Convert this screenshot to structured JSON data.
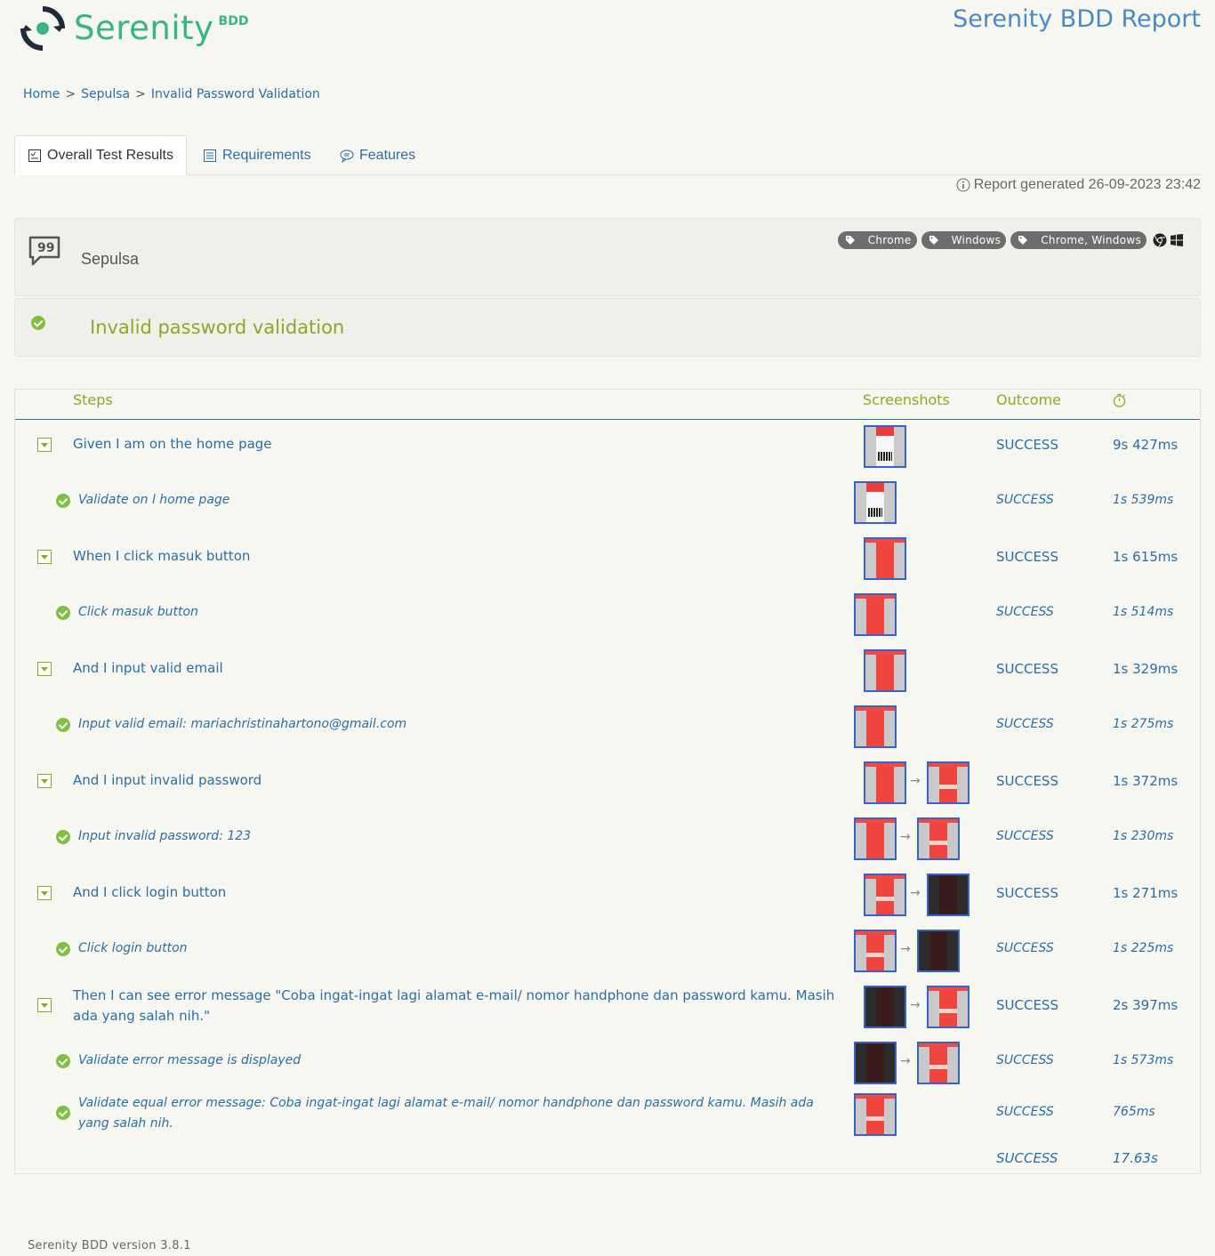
{
  "header": {
    "logo_text": "Serenity",
    "logo_sup": "BDD",
    "report_title": "Serenity BDD Report"
  },
  "breadcrumb": {
    "home": "Home",
    "sep": ">",
    "feature": "Sepulsa",
    "scenario": "Invalid Password Validation"
  },
  "tabs": [
    {
      "label": "Overall Test Results",
      "icon": "checklist-icon"
    },
    {
      "label": "Requirements",
      "icon": "list-icon"
    },
    {
      "label": "Features",
      "icon": "comment-icon"
    }
  ],
  "report_generated": "Report generated 26-09-2023 23:42",
  "feature": {
    "name": "Sepulsa",
    "tags": [
      "Chrome",
      "Windows",
      "Chrome, Windows"
    ]
  },
  "scenario": {
    "title": "Invalid password validation"
  },
  "table": {
    "headers": {
      "steps": "Steps",
      "screenshots": "Screenshots",
      "outcome": "Outcome",
      "duration": "stopwatch-icon"
    },
    "rows": [
      {
        "text": "Given I am on the home page",
        "outcome": "SUCCESS",
        "duration": "9s 427ms"
      },
      {
        "text": "Validate on l home page",
        "outcome": "SUCCESS",
        "duration": "1s 539ms"
      },
      {
        "text": "When I click masuk button",
        "outcome": "SUCCESS",
        "duration": "1s 615ms"
      },
      {
        "text": "Click masuk button",
        "outcome": "SUCCESS",
        "duration": "1s 514ms"
      },
      {
        "text": "And I input valid email",
        "outcome": "SUCCESS",
        "duration": "1s 329ms"
      },
      {
        "text": "Input valid email: mariachristinahartono@gmail.com",
        "outcome": "SUCCESS",
        "duration": "1s 275ms"
      },
      {
        "text": "And I input invalid password",
        "outcome": "SUCCESS",
        "duration": "1s 372ms"
      },
      {
        "text": "Input invalid password: 123",
        "outcome": "SUCCESS",
        "duration": "1s 230ms"
      },
      {
        "text": "And I click login button",
        "outcome": "SUCCESS",
        "duration": "1s 271ms"
      },
      {
        "text": "Click login button",
        "outcome": "SUCCESS",
        "duration": "1s 225ms"
      },
      {
        "text": "Then I can see error message \"Coba ingat-ingat lagi alamat e-mail/ nomor handphone dan password kamu. Masih ada yang salah nih.\"",
        "outcome": "SUCCESS",
        "duration": "2s 397ms"
      },
      {
        "text": "Validate error message is displayed",
        "outcome": "SUCCESS",
        "duration": "1s 573ms"
      },
      {
        "text": "Validate equal error message: Coba ingat-ingat lagi alamat e-mail/ nomor handphone dan password kamu. Masih ada yang salah nih.",
        "outcome": "SUCCESS",
        "duration": "765ms"
      }
    ],
    "total": {
      "outcome": "SUCCESS",
      "duration": "17.63s"
    }
  },
  "arrow": "→",
  "footer": "Serenity BDD version 3.8.1"
}
